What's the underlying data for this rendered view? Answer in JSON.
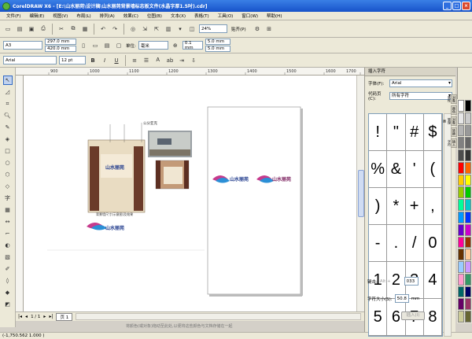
{
  "window": {
    "title": "CorelDRAW X6 - [E:\\山水丽苑\\设计稿\\山水丽苑背景墙标志板文件(水晶字厚1.5吋).cdr]"
  },
  "menu": [
    "文件(F)",
    "编辑(E)",
    "视图(V)",
    "布局(L)",
    "排列(A)",
    "效果(C)",
    "位图(B)",
    "文本(X)",
    "表格(T)",
    "工具(O)",
    "窗口(W)",
    "帮助(H)"
  ],
  "toolbar": {
    "zoom": "24%",
    "snap": "贴齐(P)"
  },
  "propbar": {
    "page_size": "A3",
    "width": "297.0 mm",
    "height": "420.0 mm",
    "units_label": "单位:",
    "units": "毫米",
    "nudge": "0.1 mm",
    "dup_x": "5.0 mm",
    "dup_y": "5.0 mm"
  },
  "textbar": {
    "font": "Arial",
    "size": "12 pt"
  },
  "ruler": {
    "h_labels": [
      "900",
      "1000",
      "1100",
      "1200",
      "1300",
      "1400",
      "1500",
      "1600",
      "1700"
    ]
  },
  "canvas": {
    "callout_label": "公分亚克",
    "caption_text": "背景墙尺寸(示意图)及效果",
    "logo_name": "山水丽苑"
  },
  "pagebar": {
    "page_count": "1 / 1",
    "page_tab": "页 1"
  },
  "hint": "将颜色(或对象)拖动至此处,以便将这些颜色与文档存储在一起",
  "status": "(-1,750.562  1.000 )",
  "docker": {
    "title": "插入字符",
    "font_label": "字体(F):",
    "font_value": "Arial",
    "codepage_label": "代码页(C):",
    "codepage_value": "所有字符",
    "glyphs": [
      "!",
      "\"",
      "#",
      "$",
      "%",
      "&",
      "'",
      "(",
      ")",
      "*",
      "+",
      ",",
      "-",
      ".",
      "/",
      "0",
      "1",
      "2",
      "3",
      "4",
      "5",
      "6",
      "7",
      "8"
    ],
    "keystroke_label": "键击:",
    "keystroke_alt": "Alt +",
    "keystroke_code": "033",
    "size_label": "字符大小(S):",
    "size_value": "50.8",
    "size_unit": "mm",
    "insert_label": "插入(I)",
    "side_tabs": [
      "对象属性",
      "颜色",
      "对象管理器",
      "转换",
      "插入字符"
    ]
  },
  "palette": [
    "#ffffff",
    "#000000",
    "#e6e6e6",
    "#cccccc",
    "#b3b3b3",
    "#999999",
    "#808080",
    "#666666",
    "#4d4d4d",
    "#333333",
    "#ff0000",
    "#ff6600",
    "#ffcc00",
    "#ffff00",
    "#99cc00",
    "#00cc00",
    "#00ff99",
    "#00cccc",
    "#0099ff",
    "#0033ff",
    "#6600cc",
    "#cc00cc",
    "#ff0099",
    "#993300",
    "#663300",
    "#ffcc99",
    "#99ccff",
    "#cc99ff",
    "#ff99cc",
    "#339966",
    "#006666",
    "#000066",
    "#660066",
    "#993366",
    "#cccc99",
    "#666633"
  ]
}
